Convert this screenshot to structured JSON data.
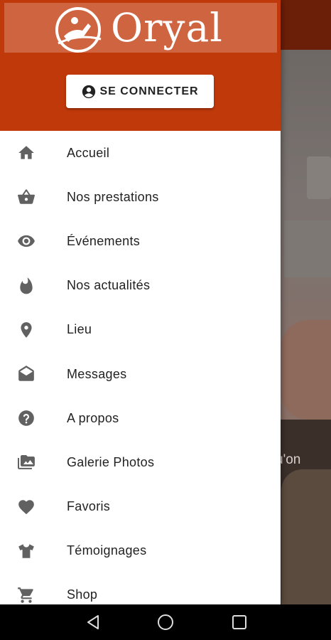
{
  "app": {
    "logo_text": "Oryal",
    "login_label": "SE CONNECTER"
  },
  "background": {
    "partial_text": "u'on"
  },
  "menu": [
    {
      "label": "Accueil",
      "icon": "home-icon"
    },
    {
      "label": "Nos prestations",
      "icon": "basket-icon"
    },
    {
      "label": "Événements",
      "icon": "eye-icon"
    },
    {
      "label": "Nos actualités",
      "icon": "flame-icon"
    },
    {
      "label": "Lieu",
      "icon": "location-pin-icon"
    },
    {
      "label": "Messages",
      "icon": "open-envelope-icon"
    },
    {
      "label": "A propos",
      "icon": "help-circle-icon"
    },
    {
      "label": "Galerie Photos",
      "icon": "photo-gallery-icon"
    },
    {
      "label": "Favoris",
      "icon": "heart-icon"
    },
    {
      "label": "Témoignages",
      "icon": "tshirt-icon"
    },
    {
      "label": "Shop",
      "icon": "cart-icon"
    }
  ],
  "colors": {
    "header": "#c0390b",
    "icon": "#616161"
  }
}
